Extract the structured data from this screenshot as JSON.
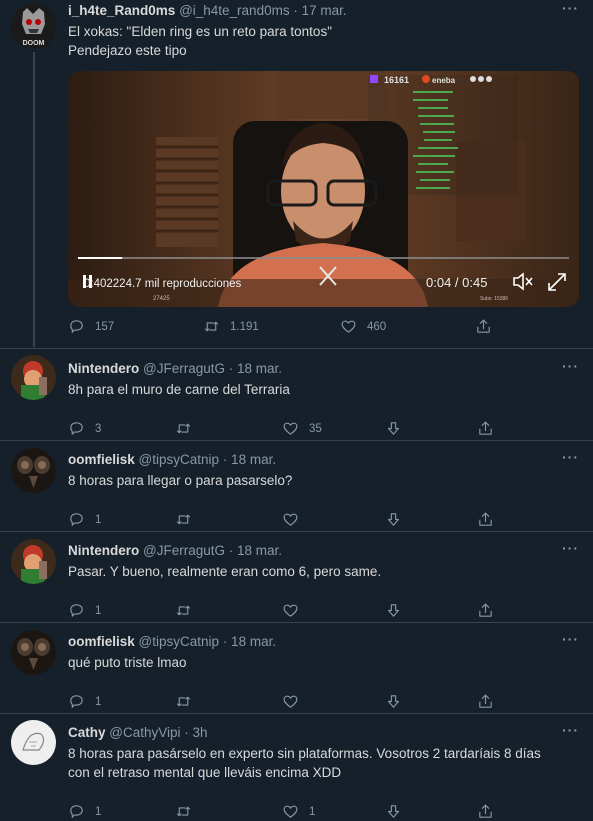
{
  "tweets": [
    {
      "name": "i_h4te_Rand0ms",
      "handle": "@i_h4te_rand0ms",
      "time": "· 17 mar.",
      "text": "El xokas: \"Elden ring es un reto para tontos\"\nPendejazo este tipo",
      "replies": "157",
      "retweets": "1.191",
      "likes": "460"
    },
    {
      "name": "Nintendero",
      "handle": "@JFerragutG",
      "time": "· 18 mar.",
      "text": "8h para el muro de carne del Terraria",
      "replies": "3",
      "retweets": "",
      "likes": "35"
    },
    {
      "name": "oomfielisk",
      "handle": "@tipsyCatnip",
      "time": "· 18 mar.",
      "text": "8 horas para llegar o para pasarselo?",
      "replies": "1",
      "retweets": "",
      "likes": ""
    },
    {
      "name": "Nintendero",
      "handle": "@JFerragutG",
      "time": "· 18 mar.",
      "text": "Pasar. Y bueno, realmente eran como 6, pero same.",
      "replies": "1",
      "retweets": "",
      "likes": ""
    },
    {
      "name": "oomfielisk",
      "handle": "@tipsyCatnip",
      "time": "· 18 mar.",
      "text": "qué puto triste lmao",
      "replies": "1",
      "retweets": "",
      "likes": ""
    },
    {
      "name": "Cathy",
      "handle": "@CathyVipi",
      "time": "· 3h",
      "text": "8 horas para pasárselo en experto sin plataformas. Vosotros 2 tardaríais 8 días\ncon el retraso mental que lleváis encima XDD",
      "replies": "1",
      "retweets": "",
      "likes": "1"
    }
  ],
  "video": {
    "views": "0:402224.7 mil reproducciones",
    "time": "0:04 / 0:45",
    "viewer_count": "16161",
    "sponsor": "eneba",
    "stat_left": "27425",
    "stat_right": "Subs: 15386",
    "progress": 0.09
  },
  "more_label": "···",
  "avatar_text_first": "DOOM"
}
